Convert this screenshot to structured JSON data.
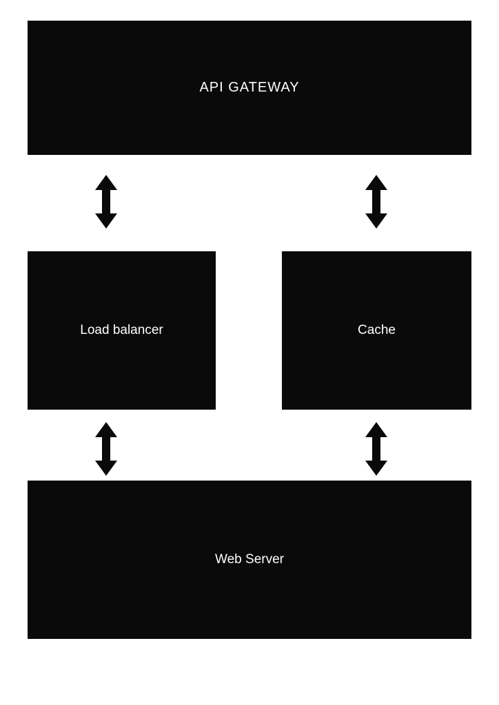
{
  "nodes": {
    "api_gateway": "API GATEWAY",
    "load_balancer": "Load balancer",
    "cache": "Cache",
    "web_server": "Web Server"
  }
}
